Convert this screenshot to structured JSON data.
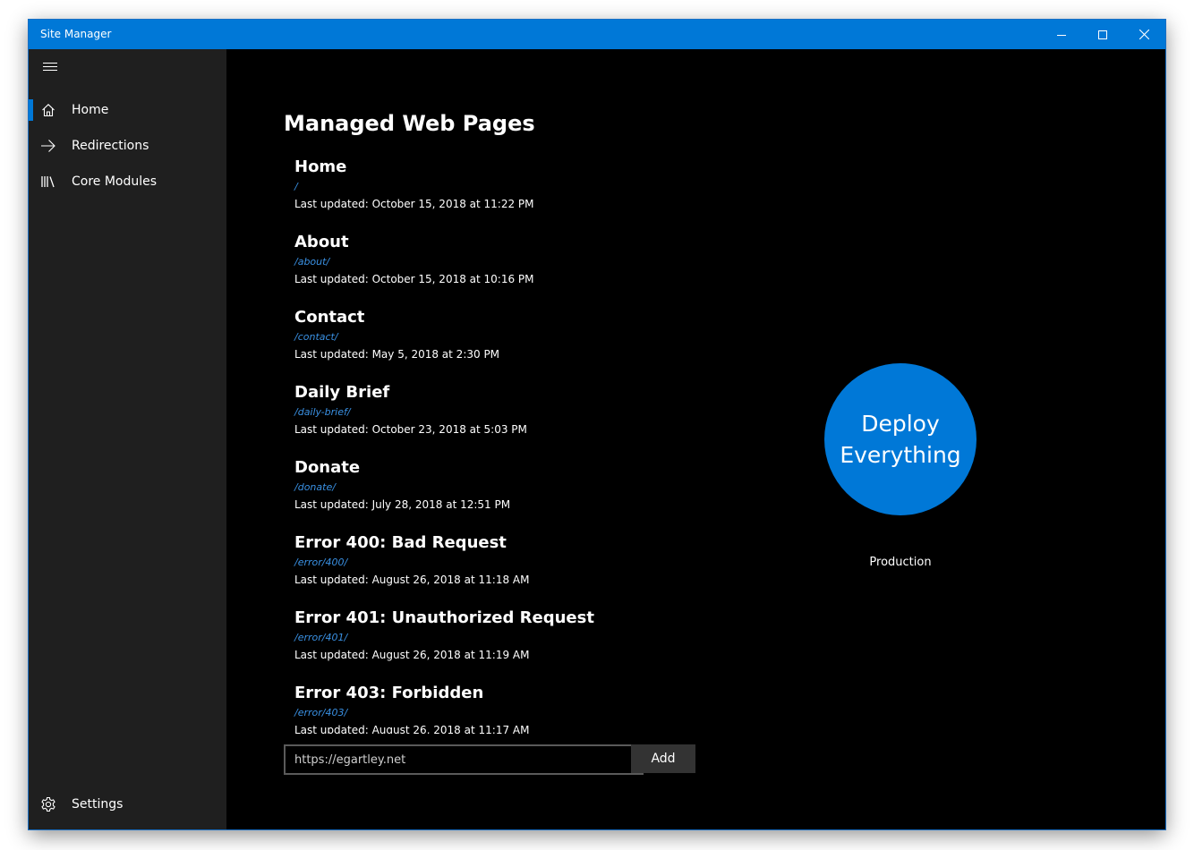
{
  "window": {
    "title": "Site Manager",
    "accent_color": "#0078d7",
    "controls": [
      "minimize",
      "maximize",
      "close"
    ]
  },
  "sidebar": {
    "menu_icon": "hamburger-icon",
    "items": [
      {
        "label": "Home",
        "icon": "home-icon",
        "selected": true
      },
      {
        "label": "Redirections",
        "icon": "arrow-right-icon",
        "selected": false
      },
      {
        "label": "Core Modules",
        "icon": "library-icon",
        "selected": false
      }
    ],
    "settings": {
      "label": "Settings",
      "icon": "gear-icon"
    }
  },
  "main": {
    "title": "Managed Web Pages",
    "pages": [
      {
        "title": "Home",
        "path": "/",
        "updated": "Last updated: October 15, 2018 at 11:22 PM"
      },
      {
        "title": "About",
        "path": "/about/",
        "updated": "Last updated: October 15, 2018 at 10:16 PM"
      },
      {
        "title": "Contact",
        "path": "/contact/",
        "updated": "Last updated: May 5, 2018 at 2:30 PM"
      },
      {
        "title": "Daily Brief",
        "path": "/daily-brief/",
        "updated": "Last updated: October 23, 2018 at 5:03 PM"
      },
      {
        "title": "Donate",
        "path": "/donate/",
        "updated": "Last updated: July 28, 2018 at 12:51 PM"
      },
      {
        "title": "Error 400: Bad Request",
        "path": "/error/400/",
        "updated": "Last updated: August 26, 2018 at 11:18 AM"
      },
      {
        "title": "Error 401: Unauthorized Request",
        "path": "/error/401/",
        "updated": "Last updated: August 26, 2018 at 11:19 AM"
      },
      {
        "title": "Error 403: Forbidden",
        "path": "/error/403/",
        "updated": "Last updated: August 26, 2018 at 11:17 AM"
      }
    ],
    "url_input": {
      "value": "",
      "placeholder": "https://egartley.net"
    },
    "add_label": "Add",
    "deploy": {
      "label": "Deploy Everything",
      "environment": "Production"
    }
  }
}
